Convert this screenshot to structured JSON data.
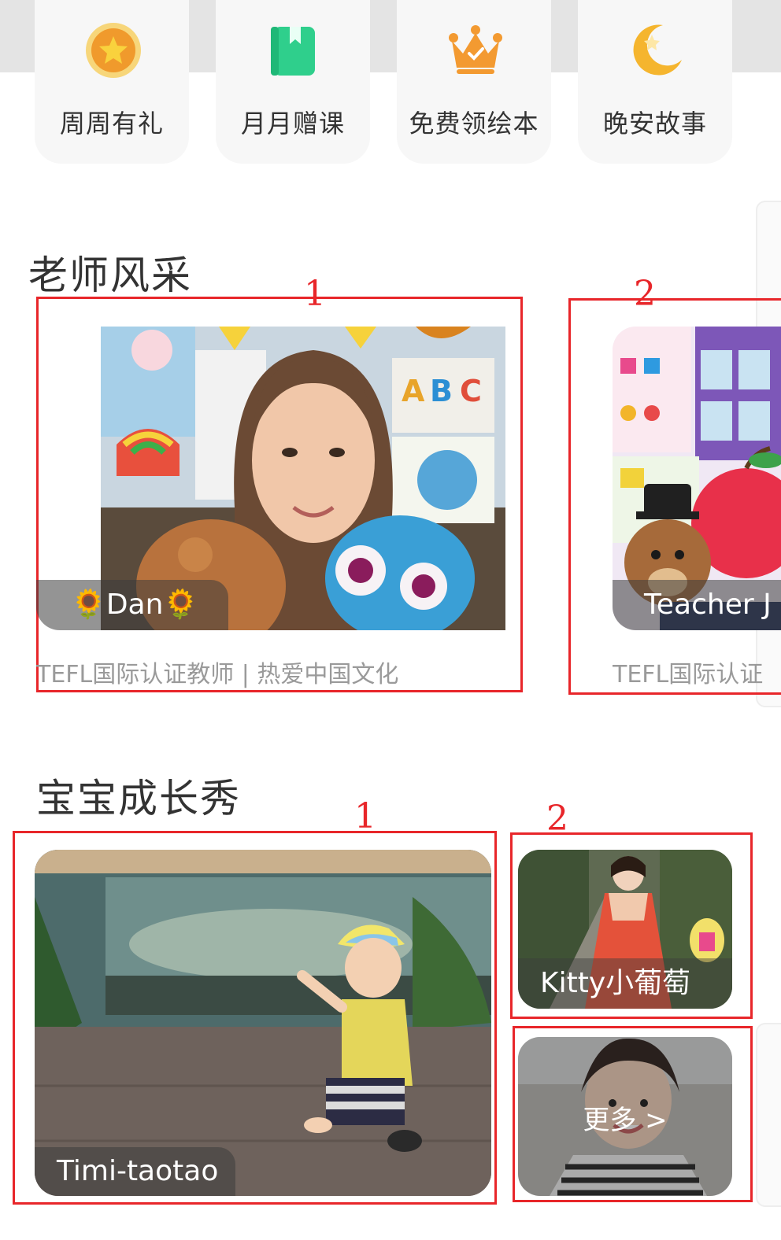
{
  "quick_entries": [
    {
      "label": "周周有礼",
      "icon": "star-medal-icon",
      "color": "#f4a12c"
    },
    {
      "label": "月月赠课",
      "icon": "green-book-icon",
      "color": "#2fcf8c"
    },
    {
      "label": "免费领绘本",
      "icon": "crown-icon",
      "color": "#f39a31"
    },
    {
      "label": "晚安故事",
      "icon": "moon-star-icon",
      "color": "#f5b52e"
    }
  ],
  "teachers_section": {
    "title": "老师风采",
    "cards": [
      {
        "marker": "1",
        "name": "🌻Dan🌻",
        "subtitle": "TEFL国际认证教师 | 热爱中国文化"
      },
      {
        "marker": "2",
        "name": "Teacher J",
        "subtitle": "TEFL国际认证"
      }
    ]
  },
  "growth_section": {
    "title": "宝宝成长秀",
    "markers": [
      "1",
      "2"
    ],
    "cards": [
      {
        "name": "Timi-taotao"
      },
      {
        "name": "Kitty小葡萄"
      },
      {
        "name": "更多 >"
      }
    ]
  },
  "colors": {
    "annotation": "#e8262a",
    "accent_green": "#2fcf8c",
    "accent_orange": "#f4a12c"
  }
}
